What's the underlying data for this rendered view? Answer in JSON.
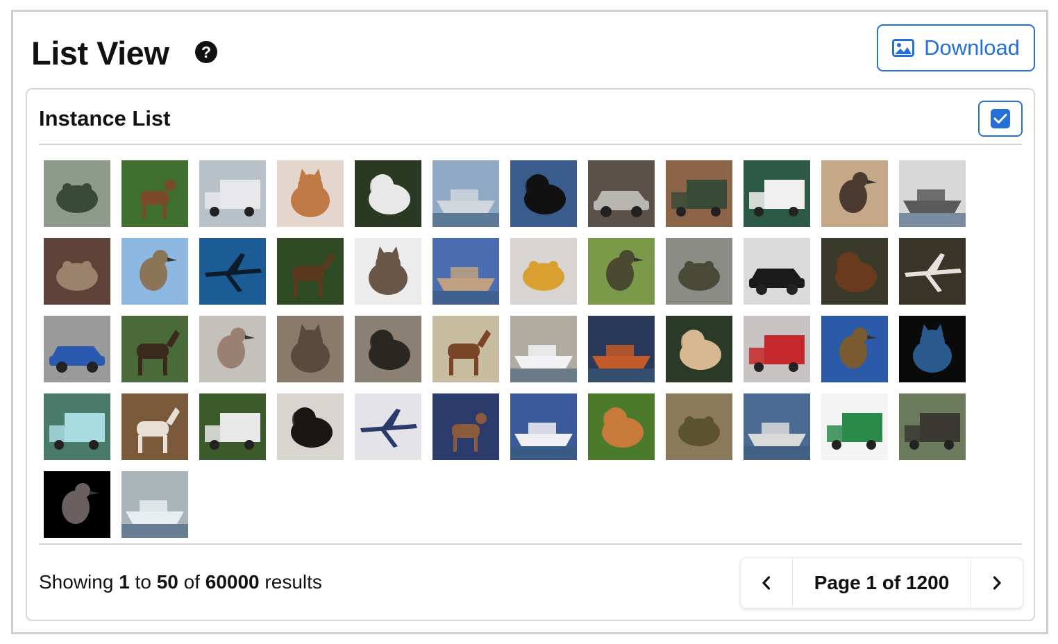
{
  "header": {
    "title": "List View",
    "help_glyph": "?",
    "help_icon": "question-circle-icon",
    "download_label": "Download",
    "download_icon": "image-icon"
  },
  "card": {
    "title": "Instance List",
    "select_all_checked": true
  },
  "thumbnails": [
    {
      "subject": "frog",
      "bg": "#8e9a8a",
      "fg": "#3a4a38"
    },
    {
      "subject": "deer",
      "bg": "#3f6e2e",
      "fg": "#7a4a2a"
    },
    {
      "subject": "truck",
      "bg": "#b8c0c8",
      "fg": "#e8e8ea"
    },
    {
      "subject": "cat",
      "bg": "#e4d6cc",
      "fg": "#c07a45"
    },
    {
      "subject": "dog",
      "bg": "#2a3a22",
      "fg": "#e8e8e8"
    },
    {
      "subject": "ship",
      "bg": "#8fa8c4",
      "fg": "#d0d6dc"
    },
    {
      "subject": "dog",
      "bg": "#3a5c8c",
      "fg": "#111111"
    },
    {
      "subject": "automobile",
      "bg": "#5b5148",
      "fg": "#b8b6b0"
    },
    {
      "subject": "truck",
      "bg": "#8c6448",
      "fg": "#3a4a38"
    },
    {
      "subject": "truck",
      "bg": "#2c5a46",
      "fg": "#f0f0f0"
    },
    {
      "subject": "bird",
      "bg": "#c4a888",
      "fg": "#4a3a30"
    },
    {
      "subject": "ship",
      "bg": "#d8d8d8",
      "fg": "#5a5a5a"
    },
    {
      "subject": "frog",
      "bg": "#5e4238",
      "fg": "#9a826c"
    },
    {
      "subject": "bird",
      "bg": "#8cb8e2",
      "fg": "#8a7656"
    },
    {
      "subject": "airplane",
      "bg": "#1c5c94",
      "fg": "#0c1c2a"
    },
    {
      "subject": "horse",
      "bg": "#2e4a22",
      "fg": "#5a3a1e"
    },
    {
      "subject": "cat",
      "bg": "#ececec",
      "fg": "#6a5646"
    },
    {
      "subject": "ship",
      "bg": "#4a6cb0",
      "fg": "#c0a080"
    },
    {
      "subject": "frog",
      "bg": "#d8d4d2",
      "fg": "#d8a030"
    },
    {
      "subject": "bird",
      "bg": "#7a9a4a",
      "fg": "#4a4a30"
    },
    {
      "subject": "frog",
      "bg": "#8c8c86",
      "fg": "#4a4a38"
    },
    {
      "subject": "automobile",
      "bg": "#dadada",
      "fg": "#1a1a1a"
    },
    {
      "subject": "dog",
      "bg": "#3a3a2a",
      "fg": "#6a3a1e"
    },
    {
      "subject": "airplane",
      "bg": "#3a3428",
      "fg": "#e8e0dc"
    },
    {
      "subject": "automobile",
      "bg": "#9a9a9a",
      "fg": "#2a5ab0"
    },
    {
      "subject": "horse",
      "bg": "#4a6a3a",
      "fg": "#3a2a1e"
    },
    {
      "subject": "bird",
      "bg": "#c4c0bc",
      "fg": "#9a8070"
    },
    {
      "subject": "cat",
      "bg": "#8a7a6a",
      "fg": "#5a4a3e"
    },
    {
      "subject": "dog",
      "bg": "#8a8074",
      "fg": "#2a2622"
    },
    {
      "subject": "horse",
      "bg": "#c8bca0",
      "fg": "#7a4426"
    },
    {
      "subject": "ship",
      "bg": "#b0aca0",
      "fg": "#f2f2f4"
    },
    {
      "subject": "ship",
      "bg": "#2a3a5a",
      "fg": "#c45a2a"
    },
    {
      "subject": "dog",
      "bg": "#2a3a26",
      "fg": "#d8b890"
    },
    {
      "subject": "truck",
      "bg": "#c8c4c4",
      "fg": "#c4282a"
    },
    {
      "subject": "bird",
      "bg": "#2a5aa8",
      "fg": "#7a5a30"
    },
    {
      "subject": "cat",
      "bg": "#0a0a0a",
      "fg": "#2a5a8c"
    },
    {
      "subject": "truck",
      "bg": "#4a7a6a",
      "fg": "#a8dce0"
    },
    {
      "subject": "horse",
      "bg": "#7a5a3a",
      "fg": "#e8e0d4"
    },
    {
      "subject": "truck",
      "bg": "#3a5a2a",
      "fg": "#e8e8e8"
    },
    {
      "subject": "dog",
      "bg": "#d8d4d0",
      "fg": "#1a1614"
    },
    {
      "subject": "airplane",
      "bg": "#e4e4e8",
      "fg": "#2a3a6a"
    },
    {
      "subject": "deer",
      "bg": "#2a3a6a",
      "fg": "#8a5a3a"
    },
    {
      "subject": "ship",
      "bg": "#3a5a9a",
      "fg": "#f0f0f2"
    },
    {
      "subject": "dog",
      "bg": "#4a7a2a",
      "fg": "#c87a3a"
    },
    {
      "subject": "frog",
      "bg": "#8a7a5a",
      "fg": "#5a5230"
    },
    {
      "subject": "ship",
      "bg": "#4a6a94",
      "fg": "#dadada"
    },
    {
      "subject": "truck",
      "bg": "#f4f4f4",
      "fg": "#2a8a4a"
    },
    {
      "subject": "truck",
      "bg": "#6a7a5a",
      "fg": "#3a3a32"
    },
    {
      "subject": "bird",
      "bg": "#000000",
      "fg": "#6a6060"
    },
    {
      "subject": "ship",
      "bg": "#a8b4b8",
      "fg": "#e8eef0"
    }
  ],
  "footer": {
    "showing_prefix": "Showing",
    "range_start": "1",
    "to_word": "to",
    "range_end": "50",
    "of_word": "of",
    "total": "60000",
    "results_word": "results",
    "page_label": "Page 1 of 1200",
    "prev_icon": "chevron-left-icon",
    "next_icon": "chevron-right-icon"
  },
  "colors": {
    "accent": "#2470d8",
    "border": "#d6d6d6"
  }
}
